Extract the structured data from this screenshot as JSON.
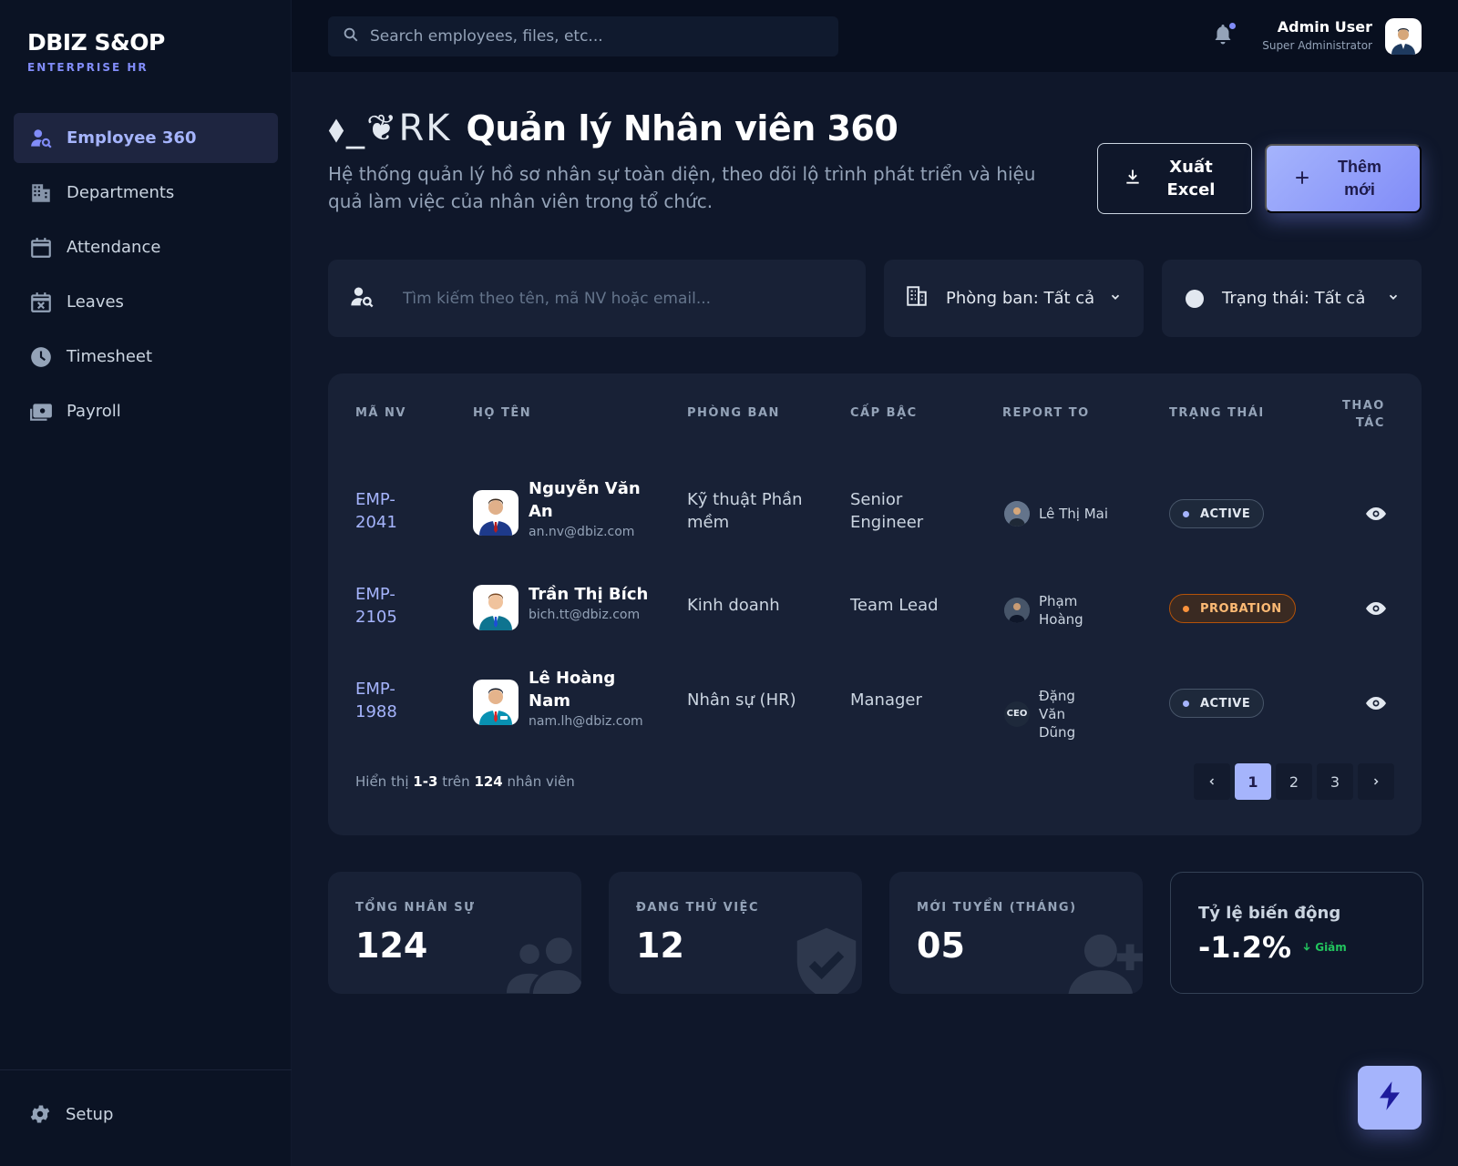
{
  "brand": {
    "name": "DBIZ S&OP",
    "subtitle": "ENTERPRISE HR"
  },
  "sidebar": {
    "items": [
      {
        "label": "Employee 360",
        "icon": "user-search-icon",
        "active": true
      },
      {
        "label": "Departments",
        "icon": "building-icon"
      },
      {
        "label": "Attendance",
        "icon": "calendar-icon"
      },
      {
        "label": "Leaves",
        "icon": "calendar-x-icon"
      },
      {
        "label": "Timesheet",
        "icon": "clock-icon"
      },
      {
        "label": "Payroll",
        "icon": "money-icon"
      }
    ],
    "setup": "Setup"
  },
  "topbar": {
    "search_placeholder": "Search employees, files, etc...",
    "user_name": "Admin User",
    "user_role": "Super Administrator"
  },
  "header": {
    "logo_glyphs": "⬧_❦RK",
    "title": "Quản lý Nhân viên 360",
    "description": "Hệ thống quản lý hồ sơ nhân sự toàn diện, theo dõi lộ trình phát triển và hiệu quả làm việc của nhân viên trong tổ chức.",
    "export_line1": "Xuất",
    "export_line2": "Excel",
    "add_line1": "Thêm",
    "add_line2": "mới"
  },
  "filters": {
    "search_placeholder": "Tìm kiếm theo tên, mã NV hoặc email...",
    "department": "Phòng ban: Tất cả",
    "status": "Trạng thái: Tất cả"
  },
  "table": {
    "headers": {
      "id": "MÃ NV",
      "name": "HỌ TÊN",
      "department": "PHÒNG BAN",
      "level": "CẤP BẬC",
      "report_to": "REPORT TO",
      "status": "TRẠNG THÁI",
      "action_line1": "THAO",
      "action_line2": "TÁC"
    },
    "rows": [
      {
        "id": "EMP-2041",
        "name": "Nguyễn Văn An",
        "email": "an.nv@dbiz.com",
        "department": "Kỹ thuật Phần mềm",
        "level": "Senior Engineer",
        "report_to": "Lê Thị Mai",
        "status": "ACTIVE"
      },
      {
        "id": "EMP-2105",
        "name": "Trần Thị Bích",
        "email": "bich.tt@dbiz.com",
        "department": "Kinh doanh",
        "level": "Team Lead",
        "report_to": "Phạm Hoàng",
        "status": "PROBATION"
      },
      {
        "id": "EMP-1988",
        "name": "Lê Hoàng Nam",
        "email": "nam.lh@dbiz.com",
        "department": "Nhân sự (HR)",
        "level": "Manager",
        "report_to": "Đặng Văn Dũng",
        "report_badge": "CEO",
        "status": "ACTIVE"
      }
    ],
    "footer": {
      "prefix": "Hiển thị",
      "range": "1-3",
      "middle": "trên",
      "total": "124",
      "suffix": "nhân viên"
    },
    "pages": [
      "1",
      "2",
      "3"
    ],
    "current_page": "1"
  },
  "stats": [
    {
      "label": "TỔNG NHÂN SỰ",
      "value": "124",
      "icon": "users-icon"
    },
    {
      "label": "ĐANG THỬ VIỆC",
      "value": "12",
      "icon": "shield-check-icon"
    },
    {
      "label": "MỚI TUYỂN (THÁNG)",
      "value": "05",
      "icon": "user-plus-icon"
    },
    {
      "label": "Tỷ lệ biến động",
      "value": "-1.2%",
      "trend": "Giảm",
      "trend_icon": "arrow-down-icon"
    }
  ],
  "colors": {
    "accent": "#a5b4fc",
    "accent_dark": "#818cf8",
    "bg": "#0f172a",
    "card": "#182136",
    "success": "#22c55e",
    "warning": "#fb923c"
  }
}
